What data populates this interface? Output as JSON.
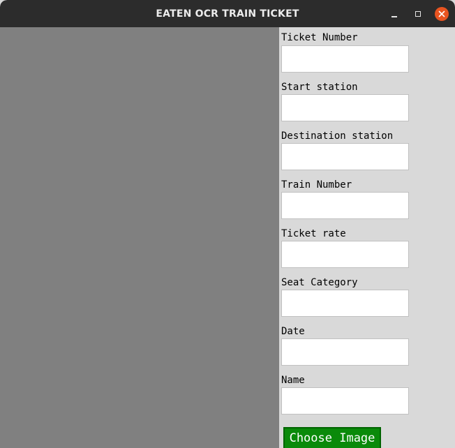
{
  "window": {
    "title": "EATEN OCR TRAIN TICKET"
  },
  "form": {
    "fields": [
      {
        "label": "Ticket Number",
        "value": ""
      },
      {
        "label": "Start station",
        "value": ""
      },
      {
        "label": "Destination station",
        "value": ""
      },
      {
        "label": "Train Number",
        "value": ""
      },
      {
        "label": "Ticket rate",
        "value": ""
      },
      {
        "label": "Seat Category",
        "value": ""
      },
      {
        "label": "Date",
        "value": ""
      },
      {
        "label": "Name",
        "value": ""
      }
    ],
    "choose_image_label": "Choose Image"
  },
  "colors": {
    "titlebar": "#2c2c2c",
    "close_button": "#e95420",
    "image_panel": "#808080",
    "form_panel": "#d9d9d9",
    "choose_button": "#0a8a0a"
  },
  "icons": [
    "minimize-icon",
    "maximize-icon",
    "close-icon"
  ]
}
